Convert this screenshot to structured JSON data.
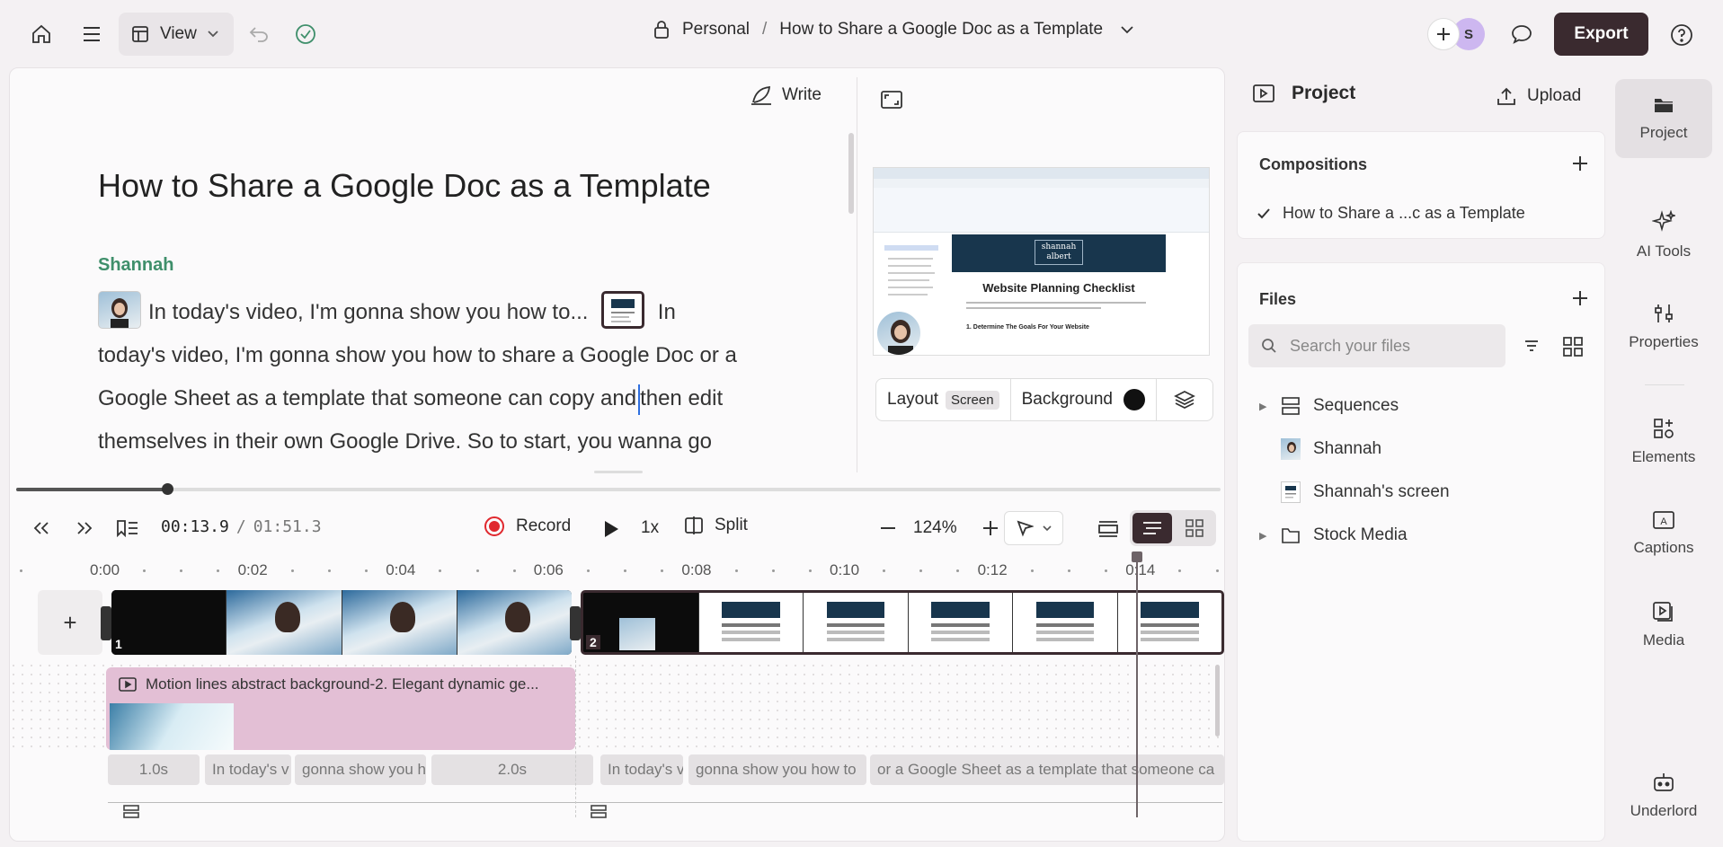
{
  "topbar": {
    "view_label": "View",
    "breadcrumb_workspace": "Personal",
    "breadcrumb_separator": "/",
    "breadcrumb_title": "How to Share a Google Doc as a Template",
    "avatar_initial": "S",
    "export_label": "Export"
  },
  "editor": {
    "write_label": "Write",
    "doc_title": "How to Share a Google Doc as a Template",
    "speaker": "Shannah",
    "transcript_part1": "In today's video, I'm gonna show you how to...",
    "transcript_part2": "In today's video, I'm gonna show you how to share a Google Doc or a Google Sheet as a template that someone can copy and",
    "transcript_part3": "then edit themselves in their own Google Drive. So to start, you wanna go"
  },
  "preview": {
    "logo_line1": "shannah",
    "logo_line2": "albert",
    "sheet_title": "Website Planning Checklist",
    "sheet_subtitle": "1. Determine The Goals For Your Website",
    "layout_label": "Layout",
    "layout_value": "Screen",
    "background_label": "Background",
    "background_color": "#111111"
  },
  "transport": {
    "current_time": "00:13.9",
    "separator": "/",
    "total_time": "01:51.3",
    "record_label": "Record",
    "speed": "1x",
    "split_label": "Split",
    "zoom": "124%",
    "progress_fraction": 0.125
  },
  "ruler": {
    "ticks": [
      "0:00",
      "0:02",
      "0:04",
      "0:06",
      "0:08",
      "0:10",
      "0:12",
      "0:14"
    ]
  },
  "timeline": {
    "add_label": "+",
    "clip1_number": "1",
    "clip2_number": "2",
    "motion_label": "Motion lines abstract background-2. Elegant dynamic ge...",
    "captions": [
      "1.0s",
      "In today's v",
      "gonna show you h",
      "2.0s",
      "In today's v",
      "gonna show you how to",
      "or a Google Sheet as a template that someone ca"
    ]
  },
  "project_panel": {
    "title": "Project",
    "upload_label": "Upload",
    "compositions_title": "Compositions",
    "composition_item": "How to Share a ...c as a Template",
    "files_title": "Files",
    "search_placeholder": "Search your files",
    "files": [
      "Sequences",
      "Shannah",
      "Shannah's screen",
      "Stock Media"
    ]
  },
  "sidebar": {
    "items": [
      "Project",
      "AI Tools",
      "Properties",
      "Elements",
      "Captions",
      "Media",
      "Underlord"
    ]
  },
  "colors": {
    "accent_dark": "#3a2a2f",
    "speaker_green": "#3f8f6b",
    "record_red": "#e0282e",
    "track_pink": "#e3bfd5",
    "avatar_purple": "#cdb7f0"
  }
}
